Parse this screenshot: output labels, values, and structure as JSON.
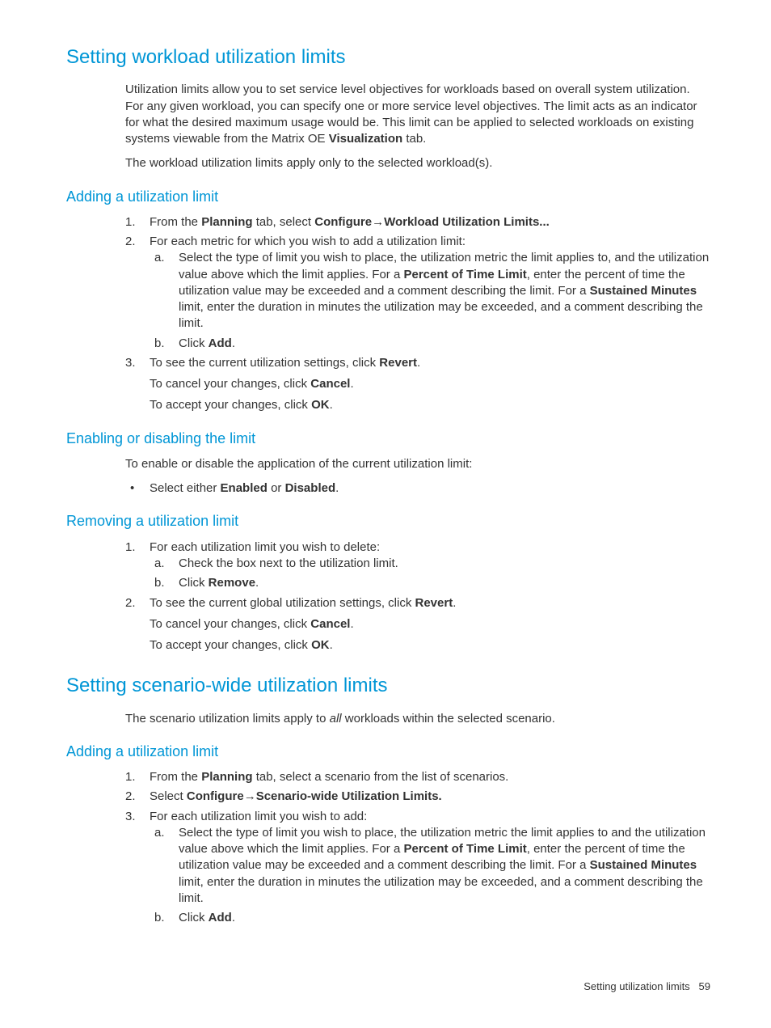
{
  "h1": "Setting workload utilization limits",
  "intro1_a": "Utilization limits allow you to set service level objectives for workloads based on overall system utilization. For any given workload, you can specify one or more service level objectives. The limit acts as an indicator for what the desired maximum usage would be. This limit can be applied to selected workloads on existing systems viewable from the Matrix OE ",
  "intro1_b": "Visualization",
  "intro1_c": " tab.",
  "intro2": "The workload utilization limits apply only to the selected workload(s).",
  "sec1_h": "Adding a utilization limit",
  "s1_1_a": "From the ",
  "s1_1_b": "Planning",
  "s1_1_c": " tab, select ",
  "s1_1_d": "Configure",
  "s1_1_e": "Workload Utilization Limits...",
  "s1_2": "For each metric for which you wish to add a utilization limit:",
  "s1_2a_a": "Select the type of limit you wish to place, the utilization metric the limit applies to, and the utilization value above which the limit applies. For a ",
  "s1_2a_b": "Percent of Time Limit",
  "s1_2a_c": ", enter the percent of time the utilization value may be exceeded and a comment describing the limit. For a ",
  "s1_2a_d": "Sustained Minutes",
  "s1_2a_e": " limit, enter the duration in minutes the utilization may be exceeded, and a comment describing the limit.",
  "s1_2b_a": "Click ",
  "s1_2b_b": "Add",
  "s1_3_a": "To see the current utilization settings, click ",
  "s1_3_b": "Revert",
  "s1_3c_a": "To cancel your changes, click ",
  "s1_3c_b": "Cancel",
  "s1_3d_a": "To accept your changes, click ",
  "s1_3d_b": "OK",
  "sec2_h": "Enabling or disabling the limit",
  "s2_intro": "To enable or disable the application of the current utilization limit:",
  "s2_b_a": "Select either ",
  "s2_b_b": "Enabled",
  "s2_b_c": " or ",
  "s2_b_d": "Disabled",
  "sec3_h": "Removing a utilization limit",
  "s3_1": "For each utilization limit you wish to delete:",
  "s3_1a": "Check the box next to the utilization limit.",
  "s3_1b_a": "Click ",
  "s3_1b_b": "Remove",
  "s3_2_a": "To see the current global utilization settings, click ",
  "s3_2_b": "Revert",
  "s3_2c_a": "To cancel your changes, click ",
  "s3_2c_b": "Cancel",
  "s3_2d_a": "To accept your changes, click ",
  "s3_2d_b": "OK",
  "h2": "Setting scenario-wide utilization limits",
  "h2_intro_a": "The scenario utilization limits apply to ",
  "h2_intro_b": "all",
  "h2_intro_c": " workloads within the selected scenario.",
  "sec4_h": "Adding a utilization limit",
  "s4_1_a": "From the ",
  "s4_1_b": "Planning",
  "s4_1_c": " tab, select a scenario from the list of scenarios.",
  "s4_2_a": "Select ",
  "s4_2_b": "Configure",
  "s4_2_c": "Scenario-wide Utilization Limits.",
  "s4_3": "For each utilization limit you wish to add:",
  "s4_3a_a": "Select the type of limit you wish to place, the utilization metric the limit applies to and the utilization value above which the limit applies. For a ",
  "s4_3a_b": "Percent of Time Limit",
  "s4_3a_c": ", enter the percent of time the utilization value may be exceeded and a comment describing the limit. For a ",
  "s4_3a_d": "Sustained Minutes",
  "s4_3a_e": " limit, enter the duration in minutes the utilization may be exceeded, and a comment describing the limit.",
  "s4_3b_a": "Click ",
  "s4_3b_b": "Add",
  "footer_text": "Setting utilization limits",
  "footer_page": "59"
}
